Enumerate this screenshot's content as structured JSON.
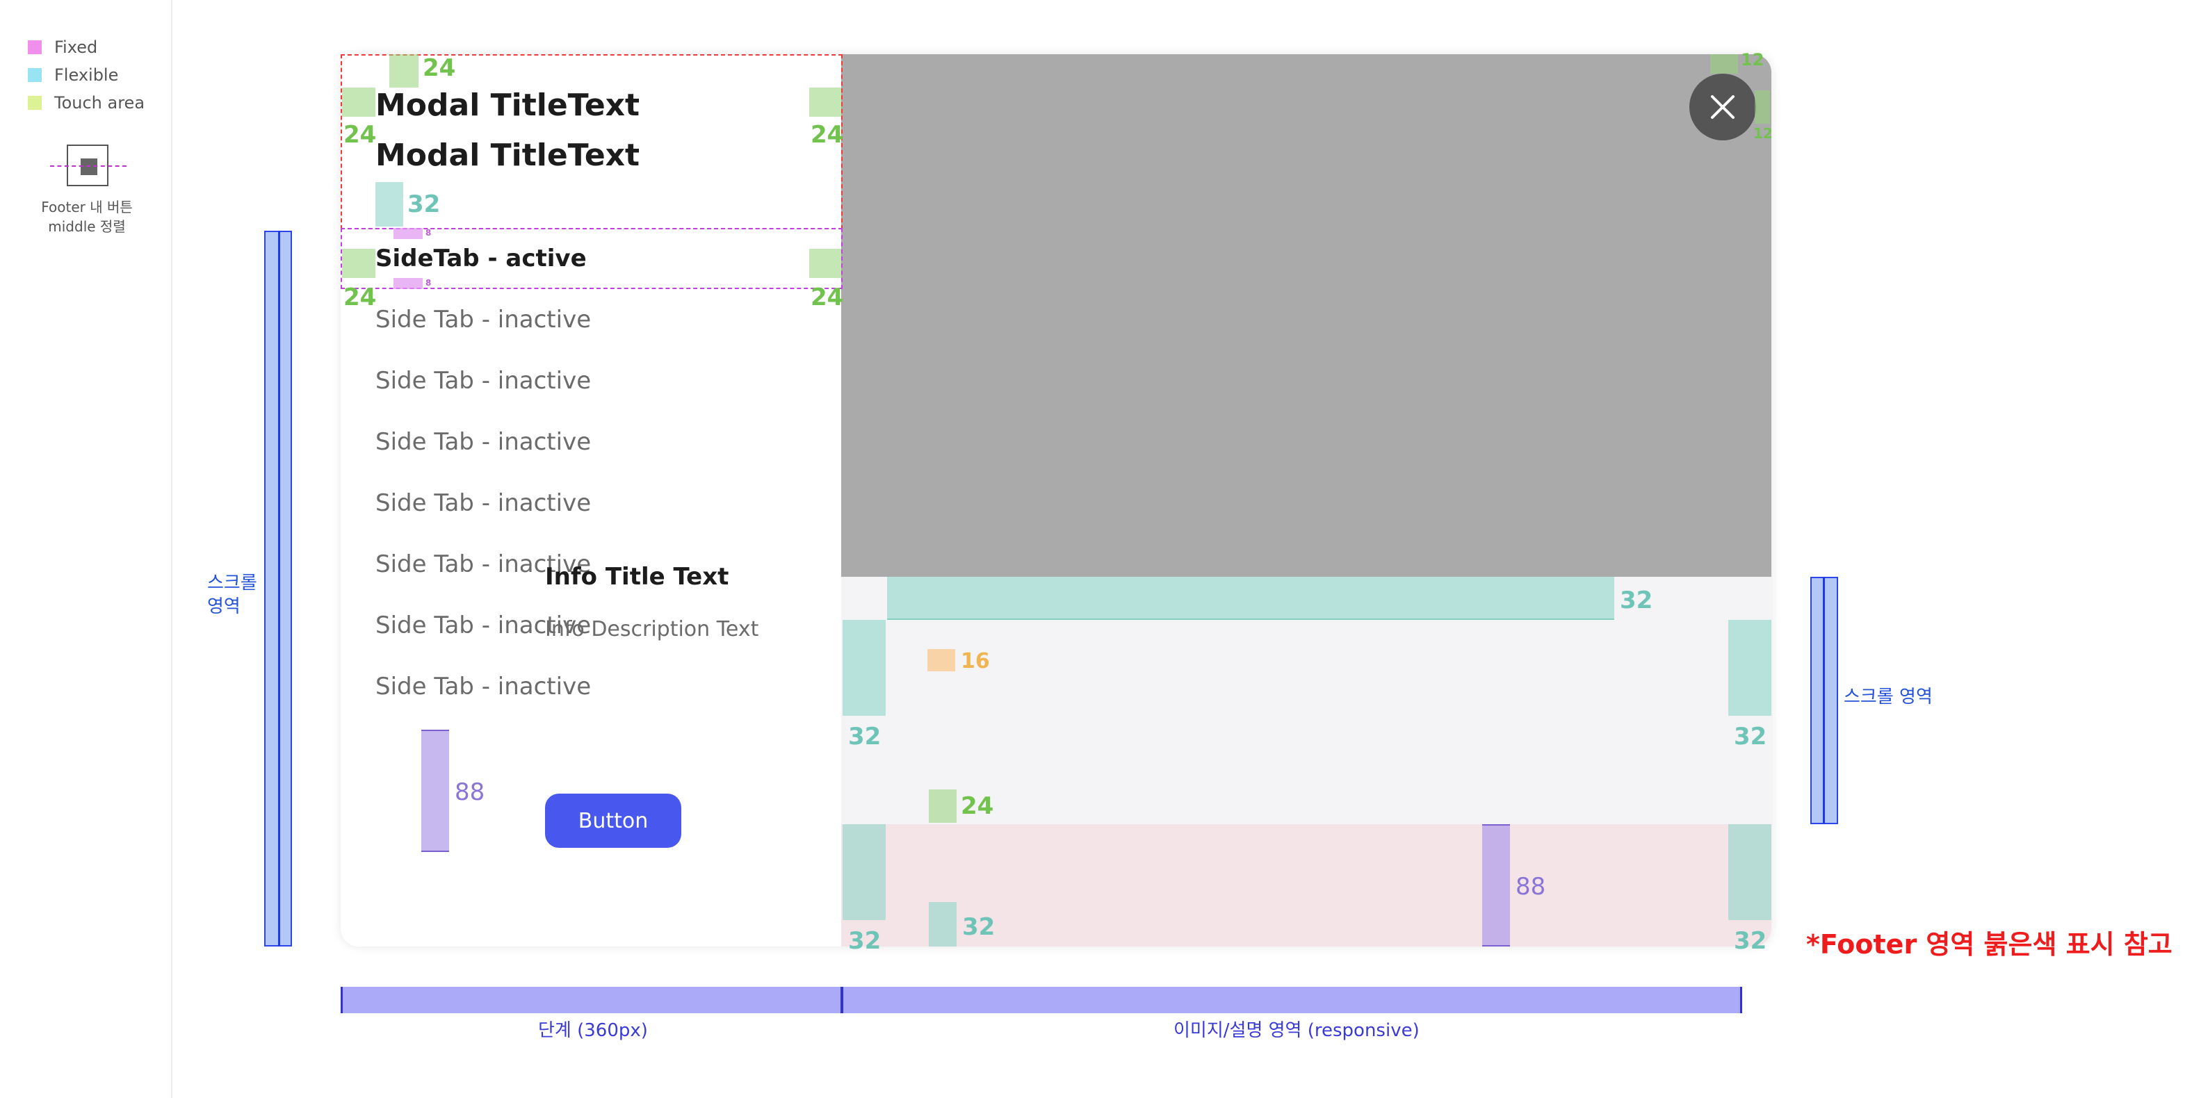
{
  "legend": {
    "items": [
      {
        "label": "Fixed",
        "color": "#f090ec"
      },
      {
        "label": "Flexible",
        "color": "#98e4f2"
      },
      {
        "label": "Touch area",
        "color": "#dcf294"
      }
    ],
    "middle_caption": "Footer 내 버튼\nmiddle 정렬"
  },
  "modal": {
    "title_line1": "Modal TitleText",
    "title_line2": "Modal TitleText",
    "active_tab": "SideTab - active",
    "inactive_tabs": [
      "Side Tab - inactive",
      "Side Tab - inactive",
      "Side Tab - inactive",
      "Side Tab - inactive",
      "Side Tab - inactive",
      "Side Tab - inactive",
      "Side Tab - inactive"
    ],
    "info_title": "Info Title Text",
    "info_desc": "Info Description Text",
    "button_label": "Button",
    "close_icon": "close-icon"
  },
  "spacing": {
    "title_top": "24",
    "title_left": "24",
    "title_right": "24",
    "title_bottom": "32",
    "tab_gap_top": "8",
    "tab_gap_bottom": "8",
    "tab_left": "24",
    "tab_right": "24",
    "sidebar_bottom": "88",
    "close_offset_top": "12",
    "close_offset_right": "12",
    "info_top": "32",
    "info_gap": "16",
    "info_left": "32",
    "info_right": "32",
    "footer_top": "24",
    "footer_height": "88",
    "footer_left": "32",
    "footer_right": "32",
    "button_bottom": "32"
  },
  "annotations": {
    "scroll_left": "스크롤\n영역",
    "scroll_right": "스크롤 영역",
    "dim_left": "단계 (360px)",
    "dim_right": "이미지/설명 영역 (responsive)",
    "footer_note": "*Footer 영역 붉은색 표시 참고"
  },
  "colors": {
    "button": "#4858ee",
    "image_placeholder": "#aaaaaa",
    "footer_highlight": "#f4e4e8",
    "note": "#ee1c1c"
  }
}
